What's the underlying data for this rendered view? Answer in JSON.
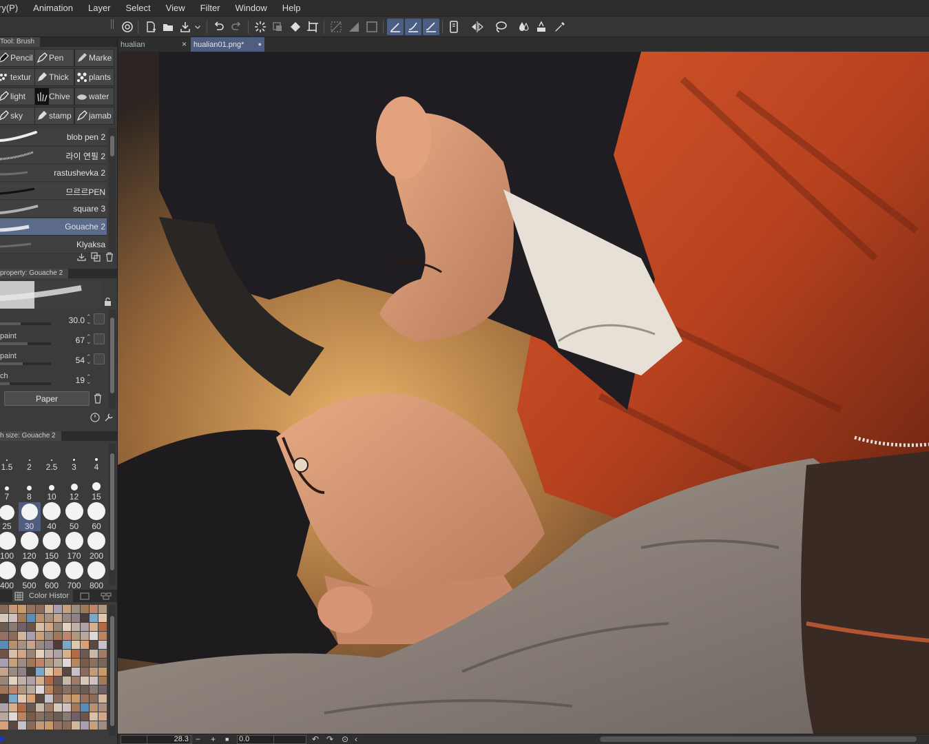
{
  "menu": [
    "ry(P)",
    "Animation",
    "Layer",
    "Select",
    "View",
    "Filter",
    "Window",
    "Help"
  ],
  "tabs": [
    {
      "label": "hualian",
      "close": "×"
    },
    {
      "label": "hualian01.png*",
      "close": "●"
    }
  ],
  "tool_panel": {
    "title": "Tool: Brush",
    "subtools": [
      "Pencil",
      "Pen",
      "Marke",
      "textur",
      "Thick",
      "plants",
      "light",
      "Chive",
      "water",
      "sky",
      "stamp",
      "jamab"
    ],
    "brushes": [
      "blob pen 2",
      "라이 연필 2",
      "rastushevka 2",
      "므르르PEN",
      "square 3",
      "Gouache 2",
      "Klyaksa"
    ],
    "selected_brush": "Gouache 2"
  },
  "property_panel": {
    "title": "property: Gouache 2",
    "rows": [
      {
        "name": "",
        "value": "30.0",
        "fill": 0.4
      },
      {
        "name": "paint",
        "value": "67",
        "fill": 0.67
      },
      {
        "name": "paint",
        "value": "54",
        "fill": 0.54
      },
      {
        "name": "ch",
        "value": "19",
        "fill": 0.19
      }
    ],
    "paper_label": "Paper"
  },
  "brush_size_panel": {
    "title": "h size: Gouache 2",
    "sizes": [
      "1.5",
      "2",
      "2.5",
      "3",
      "4",
      "7",
      "8",
      "10",
      "12",
      "15",
      "25",
      "30",
      "40",
      "50",
      "60",
      "100",
      "120",
      "150",
      "170",
      "200",
      "400",
      "500",
      "600",
      "700",
      "800"
    ],
    "selected": "30"
  },
  "color_panel": {
    "tab_label": "Color Histor"
  },
  "status": {
    "zoom": "28.3",
    "angle": "0.0"
  },
  "colors": {
    "accent": "#4e5d80",
    "menubar": "#2d2d2d",
    "panel": "#3b3b3b"
  }
}
